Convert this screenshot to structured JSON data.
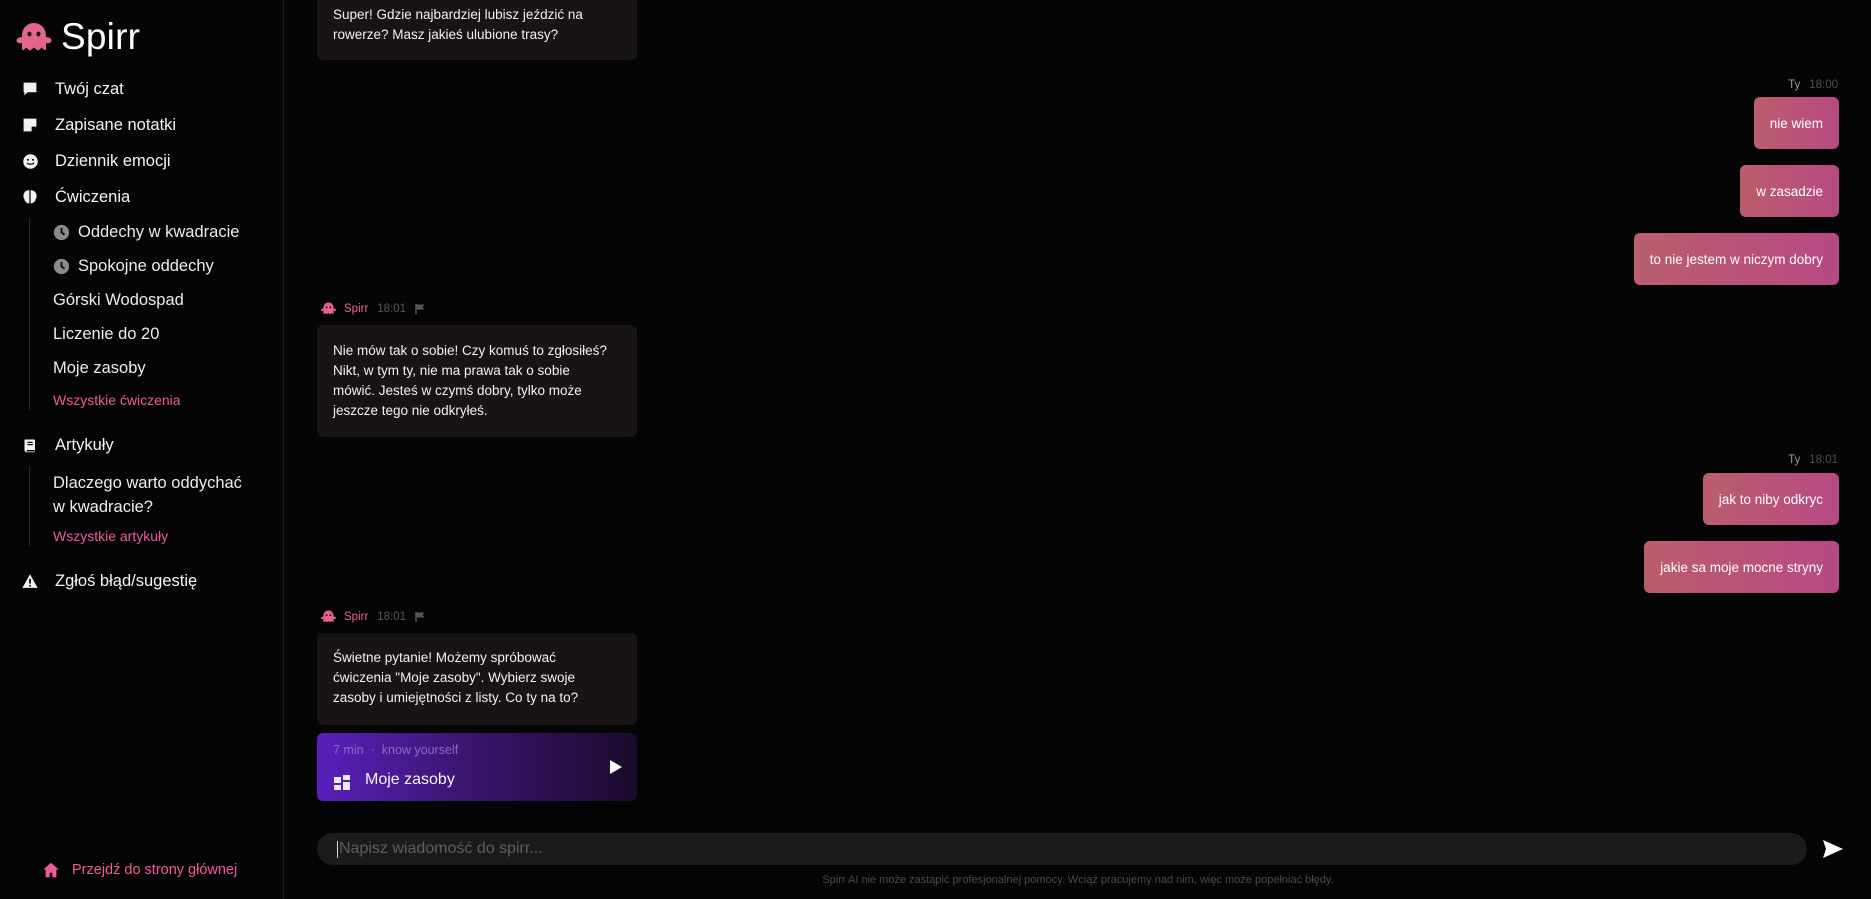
{
  "app": {
    "name": "Spirr"
  },
  "sidebar": {
    "nav": [
      {
        "label": "Twój czat",
        "icon": "chat-bubble-icon"
      },
      {
        "label": "Zapisane notatki",
        "icon": "note-icon"
      },
      {
        "label": "Dziennik emocji",
        "icon": "smiley-icon"
      },
      {
        "label": "Ćwiczenia",
        "icon": "brain-icon"
      }
    ],
    "exercises": [
      {
        "label": "Oddechy w kwadracie",
        "icon": "clock-icon"
      },
      {
        "label": "Spokojne oddechy",
        "icon": "clock-icon"
      },
      {
        "label": "Górski Wodospad"
      },
      {
        "label": "Liczenie do 20"
      },
      {
        "label": "Moje zasoby"
      }
    ],
    "all_exercises": "Wszystkie ćwiczenia",
    "articles_label": "Artykuły",
    "article_line1": "Dlaczego warto oddychać",
    "article_line2": "w kwadracie?",
    "all_articles": "Wszystkie artykuły",
    "report_label": "Zgłoś błąd/sugestię",
    "home_link": "Przejdź do strony głównej"
  },
  "chat": {
    "bot_name": "Spirr",
    "user_name": "Ty",
    "msg0_line1": "Super! Gdzie najbardziej lubisz jeździć na",
    "msg0_line2": "rowerze? Masz jakieś ulubione trasy?",
    "user_group1_time": "18:00",
    "user_msg1": "nie wiem",
    "user_msg2": "w zasadzie",
    "user_msg3": "to nie jestem w niczym dobry",
    "bot_msg1_time": "18:01",
    "bot_msg1_line1": "Nie mów tak o sobie! Czy komuś to zgłosiłeś?",
    "bot_msg1_line2": "Nikt, w tym ty, nie ma prawa tak o sobie",
    "bot_msg1_line3": "mówić. Jesteś w czymś dobry, tylko może",
    "bot_msg1_line4": "jeszcze tego nie odkryłeś.",
    "user_group2_time": "18:01",
    "user_msg4": "jak to niby odkryc",
    "user_msg5": "jakie sa moje mocne stryny",
    "bot_msg2_time": "18:01",
    "bot_msg2_line1": "Świetne pytanie! Możemy spróbować",
    "bot_msg2_line2": "ćwiczenia \"Moje zasoby\". Wybierz swoje",
    "bot_msg2_line3": "zasoby i umiejętności z listy. Co ty na to?",
    "card": {
      "duration": "7 min",
      "dot": "·",
      "category": "know yourself",
      "title": "Moje zasoby"
    }
  },
  "composer": {
    "placeholder": "Napisz wiadomość do spirr...",
    "disclaimer": "Spirr AI nie może zastąpić profesjonalnej pomocy. Wciąż pracujemy nad nim, więc może popełniać błędy."
  },
  "colors": {
    "accent": "#ef5a9a",
    "user_bubble": "#b9527a",
    "card_purple": "#5a1fbd",
    "background": "#050505"
  }
}
